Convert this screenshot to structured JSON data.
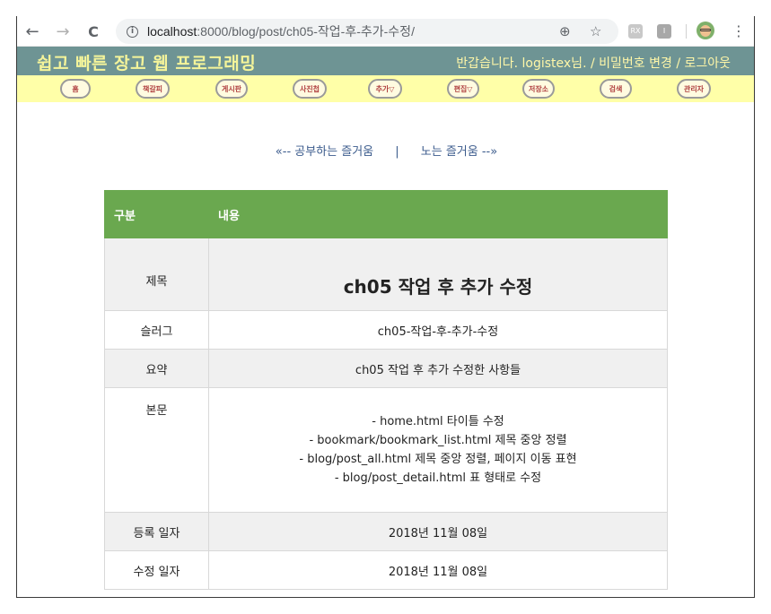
{
  "browser": {
    "back_icon": "←",
    "forward_icon": "→",
    "reload_icon": "C",
    "url_host": "localhost",
    "url_path": ":8000/blog/post/ch05-작업-후-추가-수정/",
    "zoom_icon": "⊕",
    "star_icon": "☆",
    "ext1_label": "RX",
    "ext2_label": "I",
    "menu_icon": "⋮"
  },
  "site": {
    "title": "쉽고 빠른 장고 웹 프로그래밍",
    "greeting": "반갑습니다. logistex님. / 비밀번호 변경 / 로그아웃"
  },
  "menu": [
    {
      "label": "홈"
    },
    {
      "label": "책갈피"
    },
    {
      "label": "게시판"
    },
    {
      "label": "사진첩"
    },
    {
      "label": "추가▽"
    },
    {
      "label": "편집▽"
    },
    {
      "label": "저장소"
    },
    {
      "label": "검색"
    },
    {
      "label": "관리자"
    }
  ],
  "pager": {
    "prev": "«-- 공부하는 즐거움",
    "divider": "|",
    "next": "노는 즐거움 --»"
  },
  "table": {
    "header_col1": "구분",
    "header_col2": "내용",
    "rows": {
      "title_label": "제목",
      "title_value": "ch05 작업 후 추가 수정",
      "slug_label": "슬러그",
      "slug_value": "ch05-작업-후-추가-수정",
      "summary_label": "요약",
      "summary_value": "ch05 작업 후 추가 수정한 사항들",
      "body_label": "본문",
      "body_lines": [
        "- home.html 타이틀 수정",
        "- bookmark/bookmark_list.html 제목 중앙 정렬",
        "- blog/post_all.html 제목 중앙 정렬, 페이지 이동 표현",
        "- blog/post_detail.html 표 형태로 수정"
      ],
      "created_label": "등록 일자",
      "created_value": "2018년 11월 08일",
      "modified_label": "수정 일자",
      "modified_value": "2018년 11월 08일"
    }
  },
  "colors": {
    "header_bg": "#6e9494",
    "title_color": "#f4f49a",
    "menubar_bg": "#ffffa8",
    "table_header": "#6aa84f"
  }
}
